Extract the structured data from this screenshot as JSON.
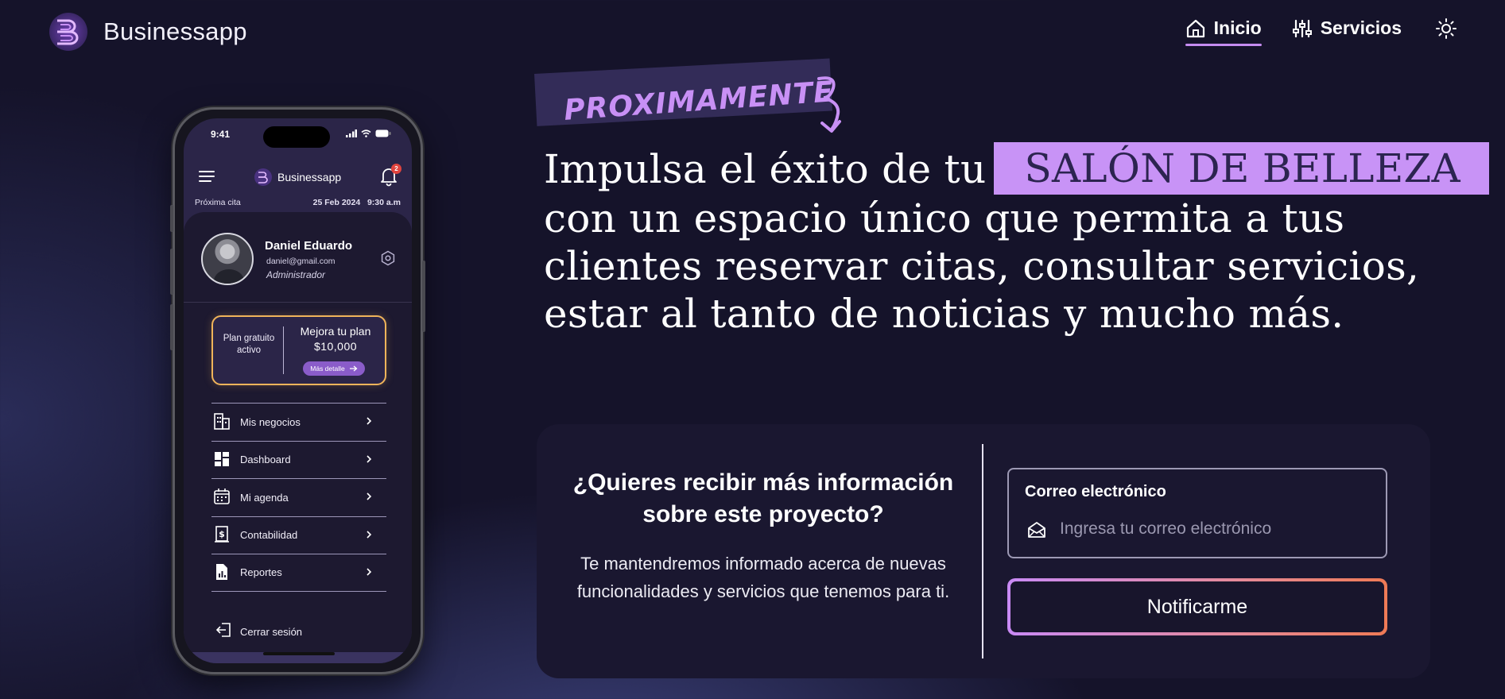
{
  "header": {
    "brand": "Businessapp",
    "nav": [
      {
        "label": "Inicio",
        "icon": "home-icon",
        "active": true
      },
      {
        "label": "Servicios",
        "icon": "sliders-icon",
        "active": false
      }
    ],
    "theme_icon": "sun-icon"
  },
  "phone": {
    "time": "9:41",
    "app_brand": "Businessapp",
    "notifications": "2",
    "next_appt_label": "Próxima cita",
    "next_appt_date": "25 Feb 2024",
    "next_appt_time": "9:30 a.m",
    "profile": {
      "name": "Daniel Eduardo",
      "email": "daniel@gmail.com",
      "role": "Administrador"
    },
    "plan": {
      "status": "Plan gratuito activo",
      "title": "Mejora tu plan",
      "price": "$10,000",
      "button": "Más detalle"
    },
    "menu": [
      {
        "label": "Mis negocios",
        "icon": "buildings-icon"
      },
      {
        "label": "Dashboard",
        "icon": "dashboard-icon"
      },
      {
        "label": "Mi agenda",
        "icon": "calendar-icon"
      },
      {
        "label": "Contabilidad",
        "icon": "receipt-icon"
      },
      {
        "label": "Reportes",
        "icon": "report-icon"
      }
    ],
    "logout": "Cerrar sesión"
  },
  "hero": {
    "tag": "PROXIMAMENTE",
    "headline_start": "Impulsa el éxito de tu",
    "highlight": "SALÓN DE BELLEZA",
    "headline_rest": "con un espacio único que permita a tus clientes reservar citas, consultar servicios, estar al tanto de noticias y mucho más."
  },
  "form": {
    "title": "¿Quieres recibir más información sobre este proyecto?",
    "description": "Te mantendremos informado acerca de nuevas funcionalidades y servicios que tenemos para ti.",
    "email_label": "Correo electrónico",
    "email_placeholder": "Ingresa tu correo electrónico",
    "email_value": "",
    "submit": "Notificarme"
  },
  "colors": {
    "background": "#15132a",
    "accent": "#c893f6",
    "plan_border": "#f0b45a",
    "button_gradient_start": "#c98af5",
    "button_gradient_end": "#ef7a55"
  }
}
